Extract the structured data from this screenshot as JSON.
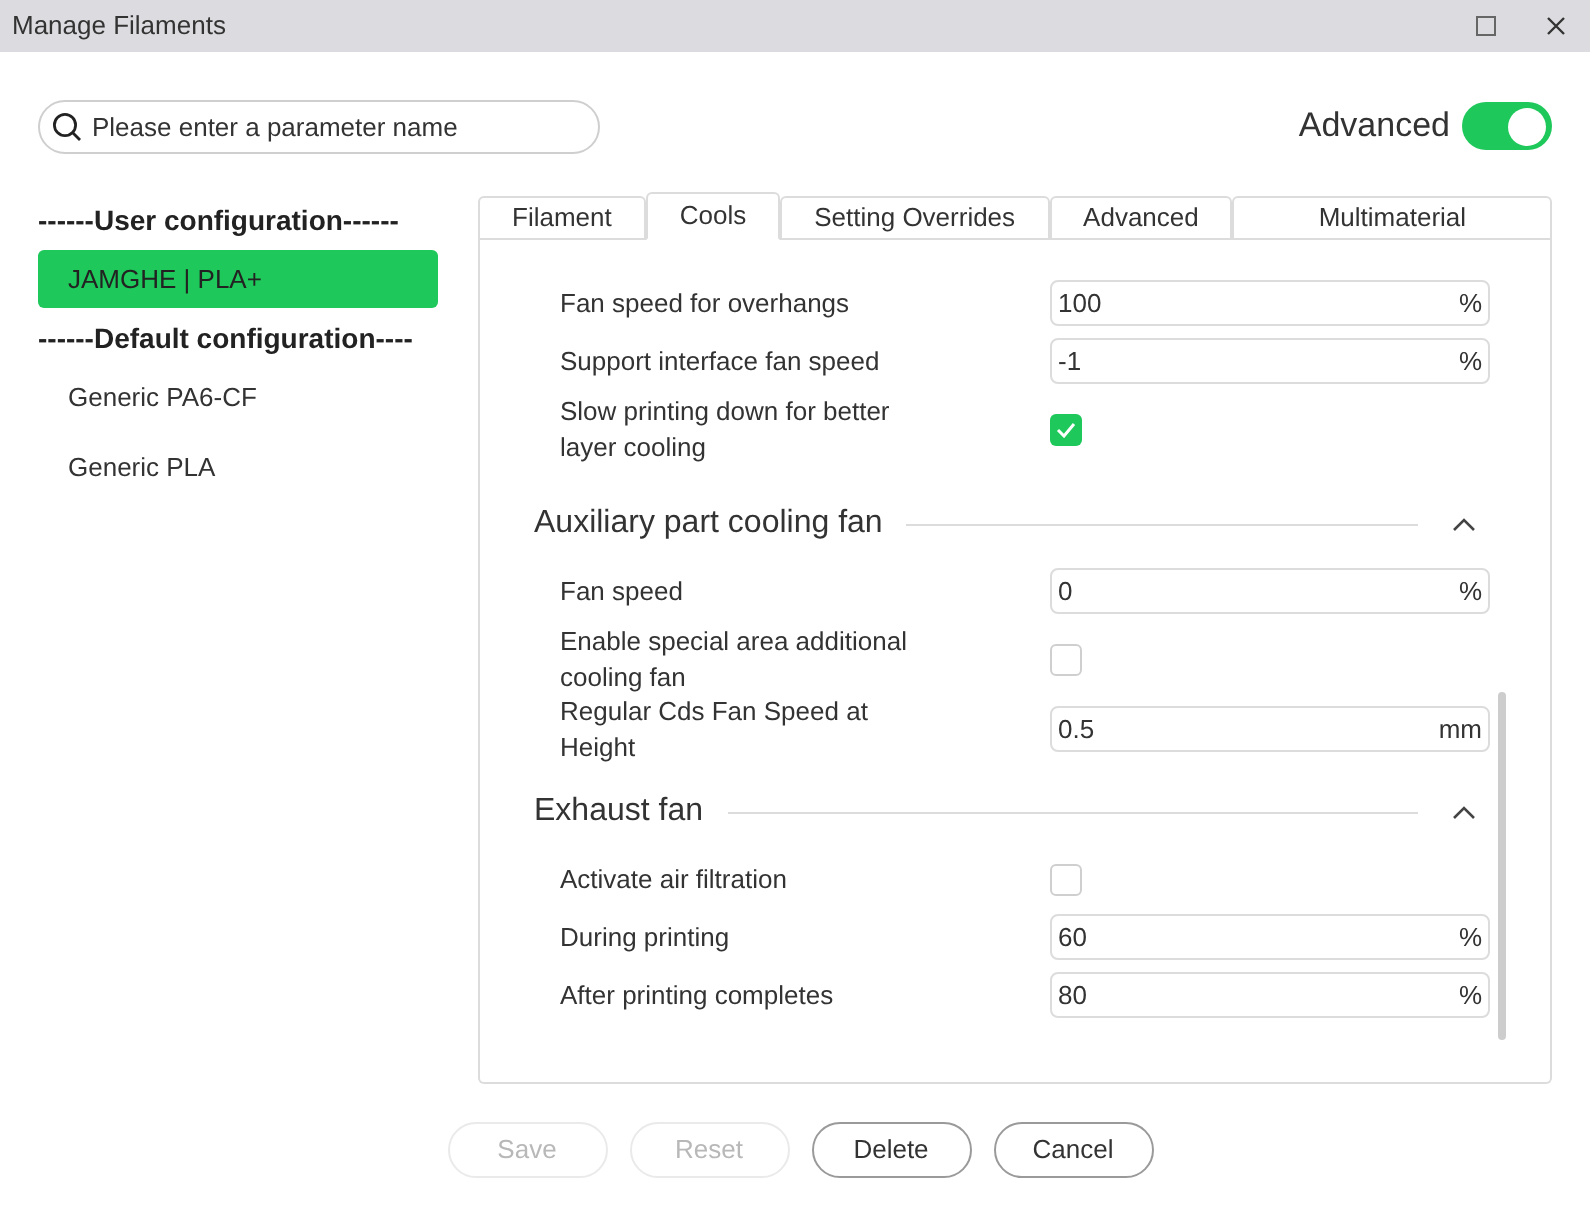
{
  "window": {
    "title": "Manage Filaments"
  },
  "search": {
    "placeholder": "Please enter a parameter name"
  },
  "advanced_toggle": {
    "label": "Advanced",
    "on": true
  },
  "sidebar": {
    "groups": [
      {
        "title": "------User configuration------",
        "items": [
          {
            "label": "JAMGHE | PLA+",
            "selected": true
          }
        ]
      },
      {
        "title": "------Default configuration----",
        "items": [
          {
            "label": "Generic PA6-CF",
            "selected": false
          },
          {
            "label": "Generic PLA",
            "selected": false
          }
        ]
      }
    ]
  },
  "tabs": [
    {
      "label": "Filament",
      "selected": false
    },
    {
      "label": "Cools",
      "selected": true
    },
    {
      "label": "Setting Overrides",
      "selected": false
    },
    {
      "label": "Advanced",
      "selected": false
    },
    {
      "label": "Multimaterial",
      "selected": false
    }
  ],
  "sections": [
    {
      "rows": [
        {
          "kind": "field",
          "label": "Fan speed for overhangs",
          "value": "100",
          "unit": "%"
        },
        {
          "kind": "field",
          "label": "Support interface fan speed",
          "value": "-1",
          "unit": "%"
        },
        {
          "kind": "checkbox",
          "label": "Slow printing down for better layer cooling",
          "checked": true
        }
      ]
    },
    {
      "title": "Auxiliary part cooling fan",
      "expanded": true,
      "rows": [
        {
          "kind": "field",
          "label": "Fan speed",
          "value": "0",
          "unit": "%"
        },
        {
          "kind": "checkbox",
          "label": "Enable special area additional cooling fan",
          "checked": false
        },
        {
          "kind": "field",
          "label": "Regular Cds Fan Speed at Height",
          "value": "0.5",
          "unit": "mm"
        }
      ]
    },
    {
      "title": "Exhaust fan",
      "expanded": true,
      "rows": [
        {
          "kind": "checkbox",
          "label": "Activate air filtration",
          "checked": false
        },
        {
          "kind": "field",
          "label": "During printing",
          "value": "60",
          "unit": "%"
        },
        {
          "kind": "field",
          "label": "After printing completes",
          "value": "80",
          "unit": "%"
        }
      ]
    }
  ],
  "buttons": [
    {
      "label": "Save",
      "disabled": true
    },
    {
      "label": "Reset",
      "disabled": true
    },
    {
      "label": "Delete",
      "disabled": false
    },
    {
      "label": "Cancel",
      "disabled": false
    }
  ]
}
